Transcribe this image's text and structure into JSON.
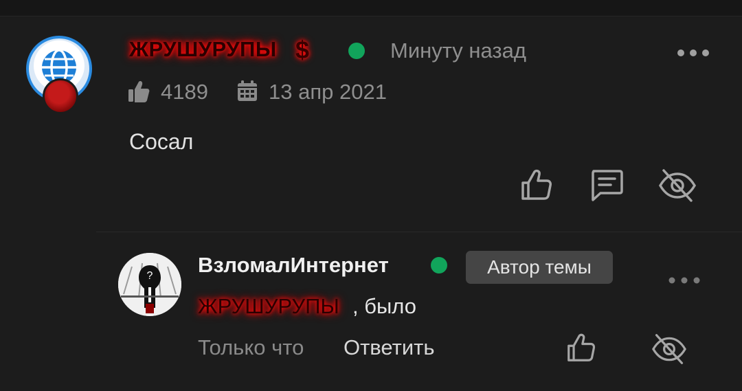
{
  "post": {
    "author": "ЖРУШУРУПЫ",
    "author_suffix": "$",
    "time": "Минуту назад",
    "likes": "4189",
    "date": "13 апр 2021",
    "body": "Сосал"
  },
  "reply": {
    "author": "ВзломалИнтернет",
    "badge": "Автор темы",
    "mention": "ЖРУШУРУПЫ",
    "text": ", было",
    "time": "Только что",
    "reply_label": "Ответить"
  },
  "colors": {
    "background": "#1c1c1c",
    "online": "#11a45b",
    "author_glow": "#ff0000",
    "muted_text": "#8f8f8f",
    "badge_bg": "#454545"
  },
  "icons": {
    "likes": "thumbs-up-icon",
    "date": "calendar-icon",
    "like_action": "thumbs-up-outline-icon",
    "reply_action": "comment-icon",
    "hide_action": "eye-off-icon",
    "more": "more-horizontal-icon"
  }
}
